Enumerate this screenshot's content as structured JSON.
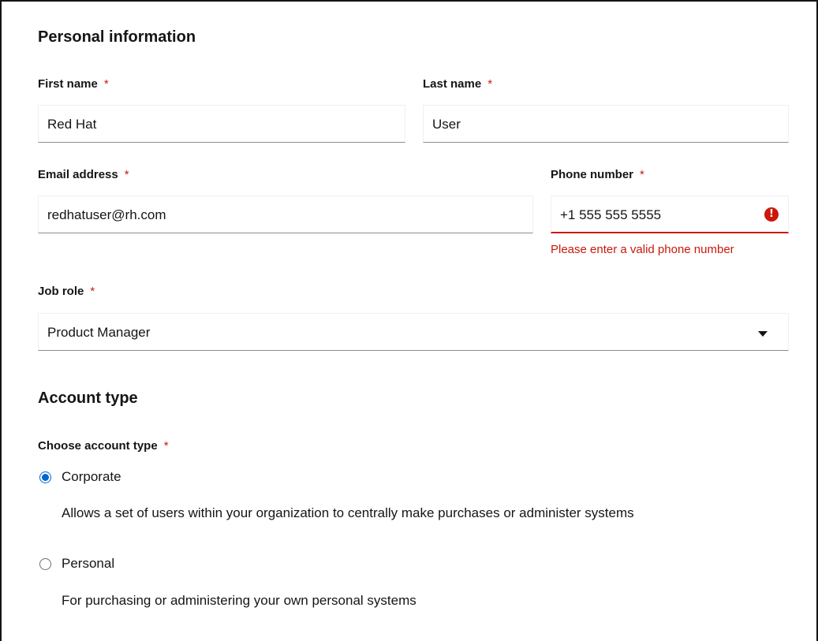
{
  "personal": {
    "title": "Personal information",
    "first_name": {
      "label": "First name",
      "required": "*",
      "value": "Red Hat"
    },
    "last_name": {
      "label": "Last name",
      "required": "*",
      "value": "User"
    },
    "email": {
      "label": "Email address",
      "required": "*",
      "value": "redhatuser@rh.com"
    },
    "phone": {
      "label": "Phone number",
      "required": "*",
      "value": "+1 555 555 5555",
      "error_icon": "!",
      "error": "Please enter a valid phone number"
    },
    "job_role": {
      "label": "Job role",
      "required": "*",
      "value": "Product Manager"
    }
  },
  "account": {
    "title": "Account type",
    "choose_label": "Choose account type",
    "required": "*",
    "options": [
      {
        "label": "Corporate",
        "description": "Allows a set of users within your organization to centrally make purchases or administer systems",
        "checked": true
      },
      {
        "label": "Personal",
        "description": "For purchasing or administering your own personal systems",
        "checked": false
      }
    ]
  },
  "colors": {
    "error": "#c9190b",
    "accent": "#0066cc"
  }
}
